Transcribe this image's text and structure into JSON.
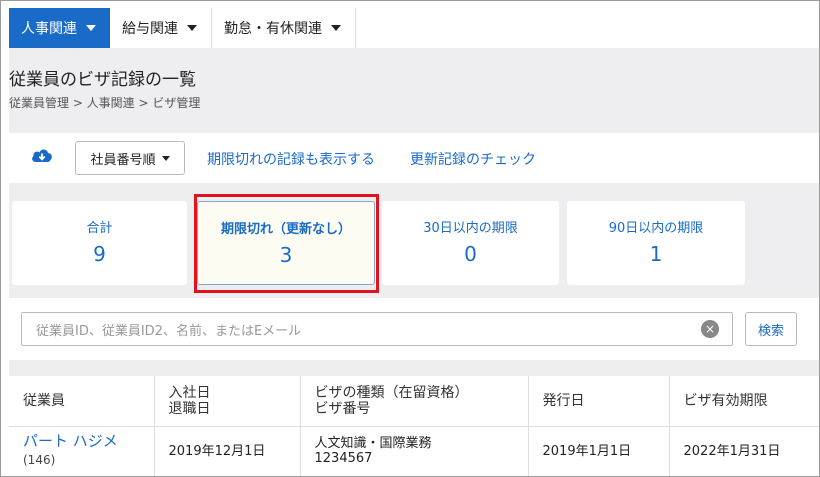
{
  "nav": {
    "items": [
      {
        "label": "人事関連",
        "active": true
      },
      {
        "label": "給与関連",
        "active": false
      },
      {
        "label": "勤怠・有休関連",
        "active": false
      }
    ]
  },
  "header": {
    "title": "従業員のビザ記録の一覧",
    "breadcrumb": "従業員管理 > 人事関連 > ビザ管理"
  },
  "toolbar": {
    "download_icon": "cloud-download-icon",
    "sort_label": "社員番号順",
    "show_expired_link": "期限切れの記録も表示する",
    "check_renewal_link": "更新記録のチェック"
  },
  "stats": [
    {
      "label": "合計",
      "value": "9"
    },
    {
      "label": "期限切れ（更新なし）",
      "value": "3"
    },
    {
      "label": "30日以内の期限",
      "value": "0"
    },
    {
      "label": "90日以内の期限",
      "value": "1"
    }
  ],
  "search": {
    "placeholder": "従業員ID、従業員ID2、名前、またはEメール",
    "button_label": "検索",
    "clear_icon": "×"
  },
  "table": {
    "headers": [
      {
        "line1": "従業員",
        "line2": ""
      },
      {
        "line1": "入社日",
        "line2": "退職日"
      },
      {
        "line1": "ビザの種類（在留資格）",
        "line2": "ビザ番号"
      },
      {
        "line1": "発行日",
        "line2": ""
      },
      {
        "line1": "ビザ有効期限",
        "line2": ""
      }
    ],
    "rows": [
      {
        "name": "パート ハジメ",
        "id": "(146)",
        "hire_date": "2019年12月1日",
        "visa_type": "人文知識・国際業務",
        "visa_number": "1234567",
        "issue_date": "2019年1月1日",
        "expiry_date": "2022年1月31日"
      }
    ]
  },
  "colors": {
    "accent": "#1a6bc7",
    "highlight_box": "#e0141e",
    "band": "#eeeef0"
  }
}
